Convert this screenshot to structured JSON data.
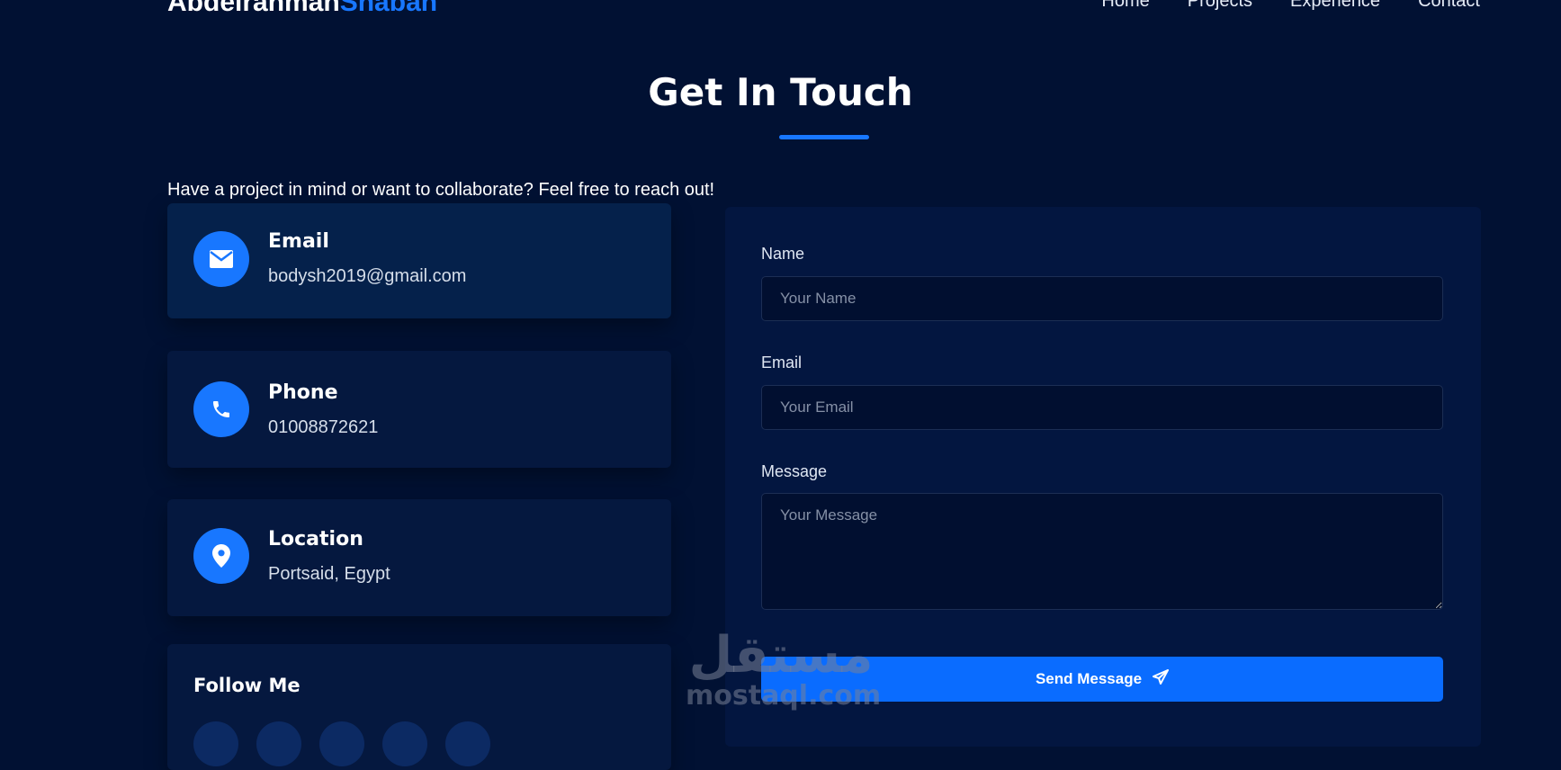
{
  "nav": {
    "logo_first": "Abdelrahman",
    "logo_second": "Shaban",
    "links": [
      "Home",
      "Projects",
      "Experience",
      "Contact"
    ]
  },
  "section": {
    "title": "Get In Touch",
    "intro": "Have a project in mind or want to collaborate? Feel free to reach out!"
  },
  "contact_cards": [
    {
      "label": "Email",
      "value": "bodysh2019@gmail.com",
      "icon": "envelope-icon"
    },
    {
      "label": "Phone",
      "value": "01008872621",
      "icon": "phone-icon"
    },
    {
      "label": "Location",
      "value": "Portsaid, Egypt",
      "icon": "map-pin-icon"
    }
  ],
  "follow": {
    "title": "Follow Me"
  },
  "form": {
    "name_label": "Name",
    "name_placeholder": "Your Name",
    "email_label": "Email",
    "email_placeholder": "Your Email",
    "message_label": "Message",
    "message_placeholder": "Your Message",
    "submit_label": "Send Message"
  },
  "watermark": {
    "arabic": "مستقل",
    "latin": "mostaql.com"
  },
  "colors": {
    "background": "#011133",
    "accent": "#1877ff",
    "card": "#05183f"
  }
}
